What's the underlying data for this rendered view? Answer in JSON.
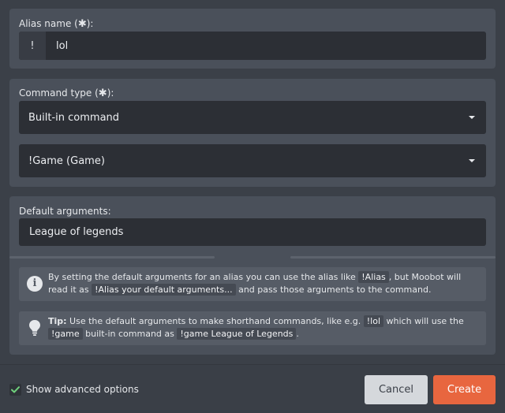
{
  "alias_section": {
    "label_prefix": "Alias name (",
    "label_star": "✱",
    "label_suffix": "):",
    "prefix_symbol": "!",
    "value": "lol"
  },
  "command_section": {
    "label_prefix": "Command type (",
    "label_star": "✱",
    "label_suffix": "):",
    "type_select": "Built-in command",
    "command_select": "!Game (Game)"
  },
  "arguments_section": {
    "label": "Default arguments:",
    "value": "League of legends"
  },
  "info_note": {
    "icon": "info-icon",
    "text_1": "By setting the default arguments for an alias you can use the alias like",
    "code_1": "!Alias",
    "text_2": ", but Moobot will read it as",
    "code_2": "!Alias your default arguments...",
    "text_3": "and pass those arguments to the command."
  },
  "tip_note": {
    "icon": "lightbulb-icon",
    "tip_label": "Tip:",
    "text_1": "Use the default arguments to make shorthand commands, like e.g.",
    "code_1": "!lol",
    "text_2": "which will use the",
    "code_2": "!game",
    "text_3": "built-in command as",
    "code_3": "!game League of Legends",
    "text_4": "."
  },
  "footer": {
    "advanced_checked": true,
    "advanced_label": "Show advanced options",
    "cancel_label": "Cancel",
    "create_label": "Create"
  },
  "colors": {
    "background": "#3b4048",
    "panel": "#4a505a",
    "field": "#2c2f35",
    "accent": "#e8663f",
    "check": "#6fcf7c"
  }
}
